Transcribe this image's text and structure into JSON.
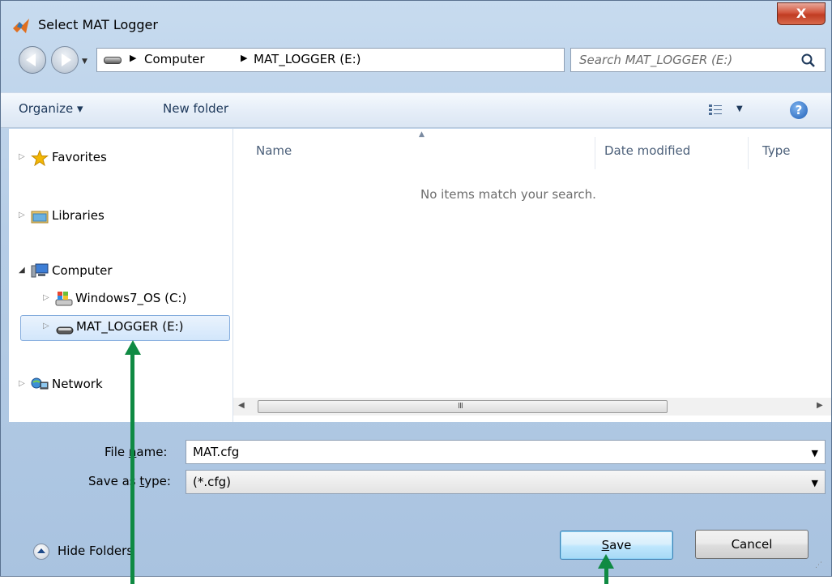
{
  "window": {
    "title": "Select MAT Logger",
    "close_label": "X"
  },
  "nav": {
    "breadcrumb": [
      "Computer",
      "MAT_LOGGER (E:)"
    ],
    "search_placeholder": "Search MAT_LOGGER (E:)"
  },
  "toolbar": {
    "organize": "Organize ▾",
    "new_folder": "New folder",
    "help": "?"
  },
  "tree": {
    "favorites": "Favorites",
    "libraries": "Libraries",
    "computer": "Computer",
    "drive_c": "Windows7_OS (C:)",
    "drive_e": "MAT_LOGGER (E:)",
    "network": "Network"
  },
  "columns": {
    "name": "Name",
    "date_modified": "Date modified",
    "type": "Type"
  },
  "empty_message": "No items match your search.",
  "form": {
    "file_name_label_pre": "File ",
    "file_name_label_u": "n",
    "file_name_label_post": "ame:",
    "file_name_value": "MAT.cfg",
    "save_type_label_pre": "Save as ",
    "save_type_label_u": "t",
    "save_type_label_post": "ype:",
    "save_type_value": "(*.cfg)"
  },
  "buttons": {
    "hide_folders": "Hide Folders",
    "save_u": "S",
    "save_rest": "ave",
    "cancel": "Cancel"
  },
  "colors": {
    "annotation_arrow": "#0f8a43",
    "accent": "#3c7fb1"
  }
}
